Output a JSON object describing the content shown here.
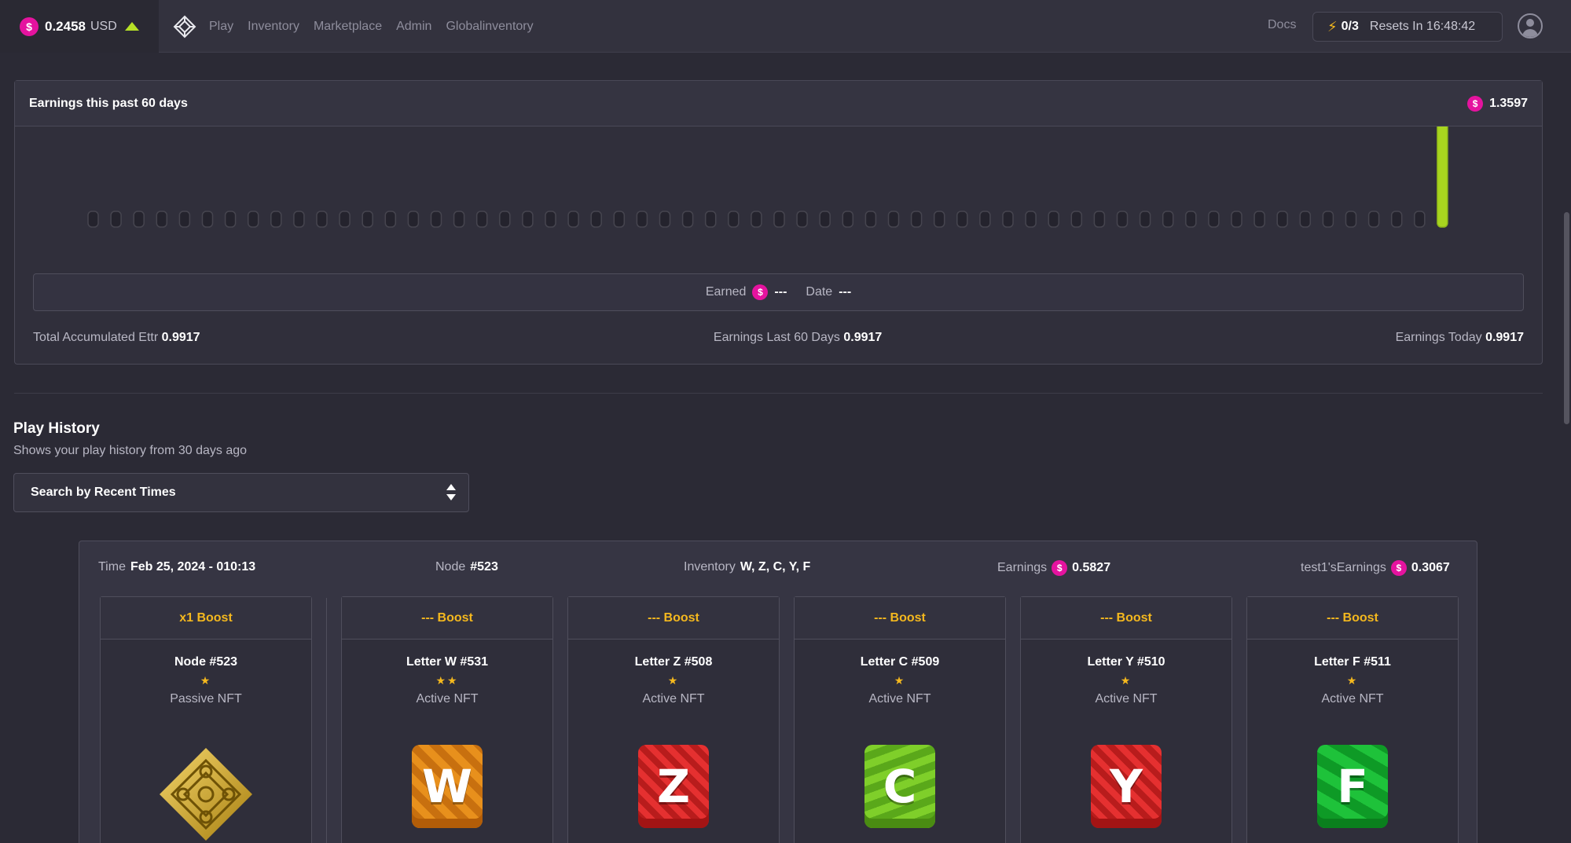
{
  "topbar": {
    "balance": "0.2458",
    "currency": "USD",
    "nav": [
      "Play",
      "Inventory",
      "Marketplace",
      "Admin",
      "Globalinventory"
    ],
    "docs": "Docs",
    "energy": "0/3",
    "resets": "Resets In 16:48:42"
  },
  "earnings": {
    "title": "Earnings this past 60 days",
    "total": "1.3597",
    "earned_label": "Earned",
    "earned_value": "---",
    "date_label": "Date",
    "date_value": "---",
    "total_accumulated_label": "Total Accumulated Ettr",
    "total_accumulated": "0.9917",
    "last60_label": "Earnings Last 60 Days",
    "last60": "0.9917",
    "today_label": "Earnings Today",
    "today": "0.9917"
  },
  "chart_data": {
    "type": "bar",
    "days": 60,
    "values": [
      0,
      0,
      0,
      0,
      0,
      0,
      0,
      0,
      0,
      0,
      0,
      0,
      0,
      0,
      0,
      0,
      0,
      0,
      0,
      0,
      0,
      0,
      0,
      0,
      0,
      0,
      0,
      0,
      0,
      0,
      0,
      0,
      0,
      0,
      0,
      0,
      0,
      0,
      0,
      0,
      0,
      0,
      0,
      0,
      0,
      0,
      0,
      0,
      0,
      0,
      0,
      0,
      0,
      0,
      0,
      0,
      0,
      0,
      0,
      0.9917
    ],
    "colors": {
      "empty": "#24232d",
      "filled": "#a8d51f"
    }
  },
  "play_history": {
    "title": "Play History",
    "subtitle": "Shows your play history from 30 days ago",
    "select": "Search by Recent Times"
  },
  "history": {
    "time_label": "Time",
    "time": "Feb 25, 2024 - 010:13",
    "node_label": "Node",
    "node": "#523",
    "inventory_label": "Inventory",
    "inventory": "W, Z, C, Y, F",
    "earnings_label": "Earnings",
    "earnings": "0.5827",
    "test_label": "test1'sEarnings",
    "test": "0.3067",
    "nfts": [
      {
        "boost": "x1 Boost",
        "name": "Node #523",
        "stars": "★",
        "kind": "Passive NFT",
        "letter": ""
      },
      {
        "boost": "--- Boost",
        "name": "Letter W #531",
        "stars": "★★",
        "kind": "Active NFT",
        "letter": "W"
      },
      {
        "boost": "--- Boost",
        "name": "Letter Z #508",
        "stars": "★",
        "kind": "Active NFT",
        "letter": "Z"
      },
      {
        "boost": "--- Boost",
        "name": "Letter C #509",
        "stars": "★",
        "kind": "Active NFT",
        "letter": "C"
      },
      {
        "boost": "--- Boost",
        "name": "Letter Y #510",
        "stars": "★",
        "kind": "Active NFT",
        "letter": "Y"
      },
      {
        "boost": "--- Boost",
        "name": "Letter F #511",
        "stars": "★",
        "kind": "Active NFT",
        "letter": "F"
      }
    ]
  },
  "icons": {
    "coin": "ettr-coin-icon",
    "logo": "diamond-logo-icon",
    "bolt": "lightning-icon",
    "user": "user-avatar-icon"
  }
}
